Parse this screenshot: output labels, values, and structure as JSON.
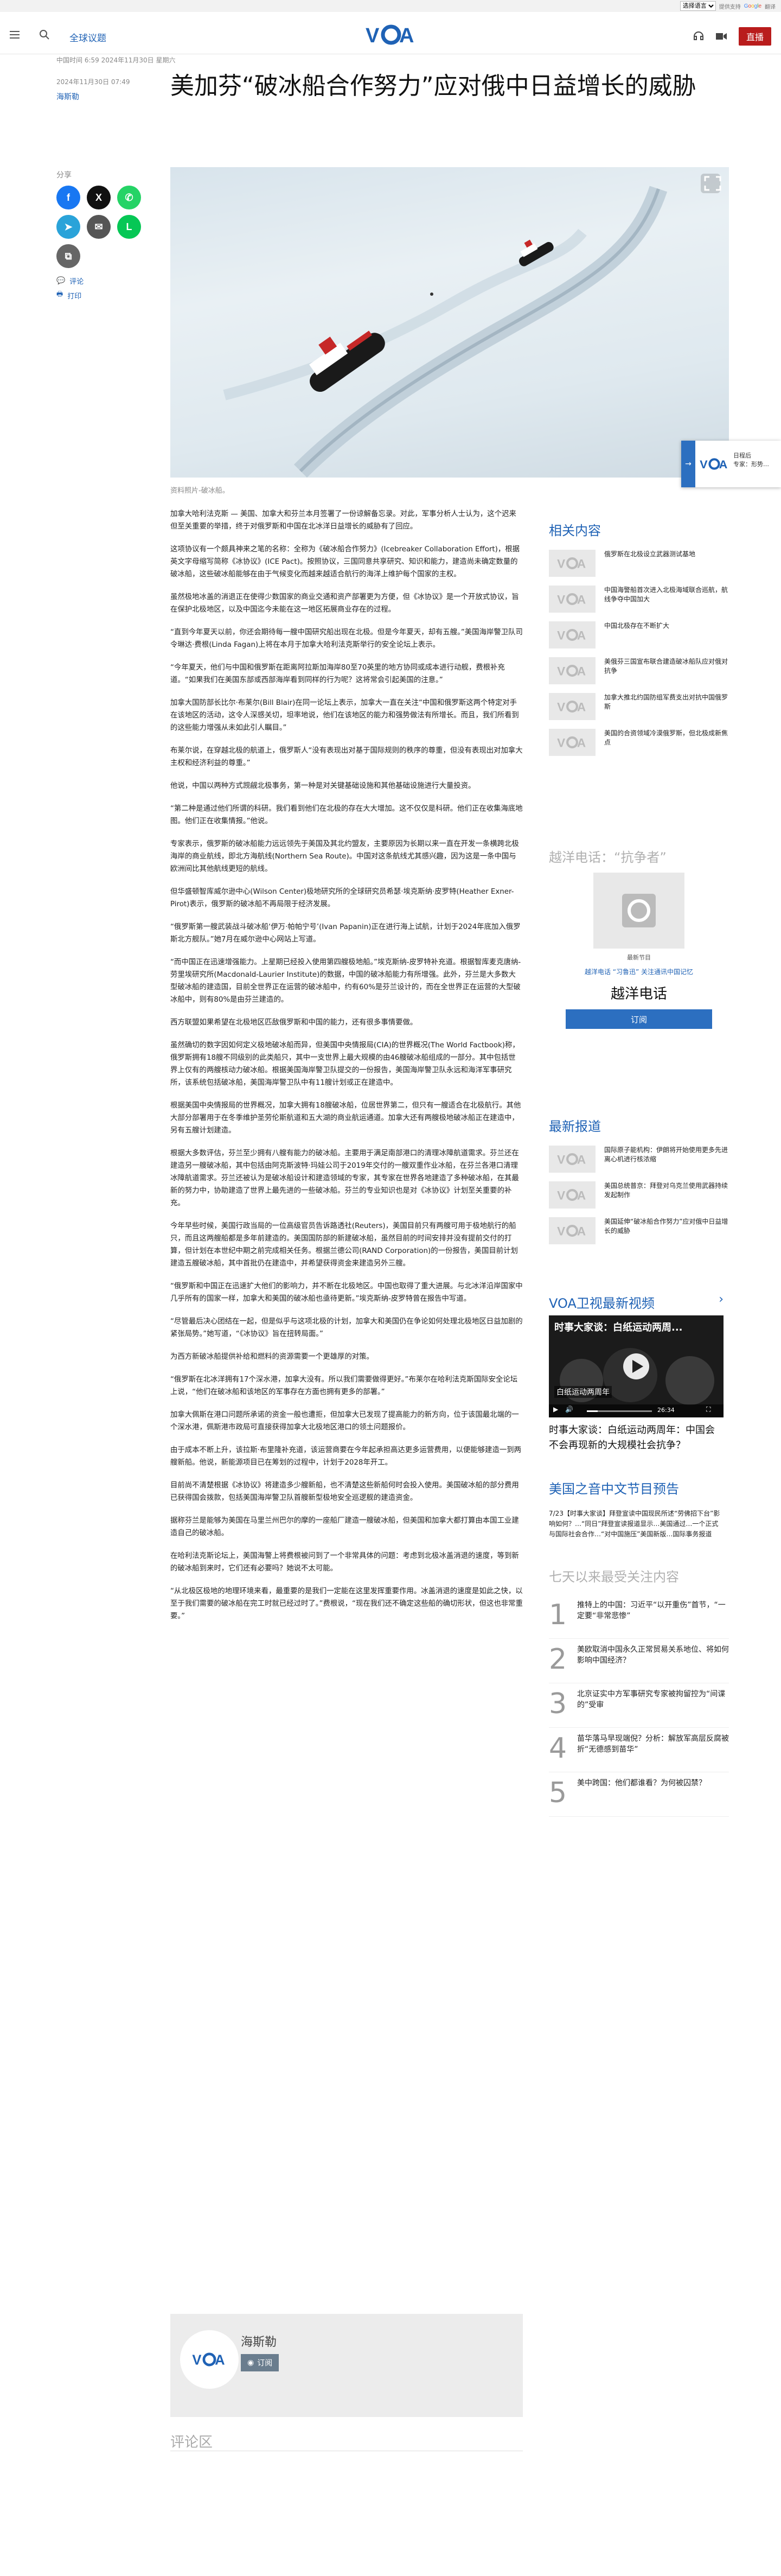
{
  "translate_bar": {
    "select_value": "选择语言",
    "powered_by": "提供支持",
    "google_text": "Google",
    "translate_word": "翻译"
  },
  "header": {
    "section": "全球议题",
    "logo_text": "VOA",
    "live_label": "直播"
  },
  "article": {
    "update_meta": "中国时间 6:59 2024年11月30日 星期六",
    "date": "2024年11月30日 07:49",
    "author": "海斯勒",
    "headline": "美加芬“破冰船合作努力”应对俄中日益增长的威胁",
    "caption": "资料照片-破冰船。",
    "paragraphs": [
      "加拿大哈利法克斯 — 美国、加拿大和芬兰本月签署了一份谅解备忘录。对此，军事分析人士认为，这个迟来但至关重要的举措，终于对俄罗斯和中国在北冰洋日益增长的威胁有了回应。",
      "这项协议有一个颇具神来之笔的名称：全称为《破冰船合作努力》(Icebreaker Collaboration Effort)，根据英文字母缩写简称《冰协议》(ICE Pact)。按照协议，三国同意共享研究、知识和能力，建造尚未确定数量的破冰船，这些破冰船能够在由于气候变化而越来越适合航行的海洋上维护每个国家的主权。",
      "虽然极地冰盖的消退正在使得少数国家的商业交通和资产部署更为方便，但《冰协议》是一个开放式协议，旨在保护北极地区，以及中国迄今未能在这一地区拓展商业存在的过程。",
      "“直到今年夏天以前，你还会期待每一艘中国研究船出现在北极。但是今年夏天，却有五艘。”美国海岸警卫队司令琳达·费根(Linda Fagan)上将在本月于加拿大哈利法克斯举行的安全论坛上表示。",
      "“今年夏天，他们与中国和俄罗斯在距离阿拉斯加海岸80至70英里的地方协同或成本进行动舰，费根补充道。“如果我们在美国东部或西部海岸看到同样的行为呢？这将常会引起美国的注意。”",
      "加拿大国防部长比尔·布莱尔(Bill Blair)在同一论坛上表示，加拿大一直在关注“中国和俄罗斯这两个特定对手在该地区的活动，这令人深感关切，坦率地说，他们在该地区的能力和强势做法有所增长。而且，我们所看到的这些能力增强从未如此引人瞩目。”",
      "布莱尔说，在穿越北极的航道上，俄罗斯人“没有表现出对基于国际规则的秩序的尊重，但没有表现出对加拿大主权和经济利益的尊重。”",
      "他说，中国以两种方式觊觎北极事务，第一种是对关键基础设施和其他基础设施进行大量投资。",
      "“第二种是通过他们所谓的科研。我们看到他们在北极的存在大大增加。这不仅仅是科研。他们正在收集海底地图。他们正在收集情报。”他说。",
      "专家表示，俄罗斯的破冰船能力远远领先于美国及其北约盟友，主要原因为长期以来一直在开发一条横跨北极海岸的商业航线，即北方海航线(Northern Sea Route)。中国对这条航线尤其感兴趣，因为这是一条中国与欧洲间比其他航线更短的航线。",
      "但华盛顿智库威尔逊中心(Wilson Center)极地研究所的全球研究员希瑟·埃克斯纳·皮罗特(Heather Exner-Pirot)表示，俄罗斯的破冰船不再局限于经济发展。",
      "“俄罗斯第一艘武装战斗破冰船‘伊万·帕帕宁号’(Ivan Papanin)正在进行海上试航，计划于2024年底加入俄罗斯北方舰队。”她7月在威尔逊中心网站上写道。",
      "“而中国正在迅速增强能力。上星期已经投入使用第四艘极地船。”埃克斯纳-皮罗特补充道。根据智库麦克唐纳-劳里埃研究所(Macdonald-Laurier Institute)的数据，中国的破冰船能力有所增强。此外，芬兰是大多数大型破冰船的建造国，目前全世界正在运营的破冰船中，约有60%是芬兰设计的，而在全世界正在运营的大型破冰船中，则有80%是由芬兰建造的。",
      "西方联盟如果希望在北极地区匹敌俄罗斯和中国的能力，还有很多事情要做。",
      "虽然确切的数字因如何定义极地破冰船而异，但美国中央情报局(CIA)的世界概况(The World Factbook)称，俄罗斯拥有18艘不同级别的此类船只，其中一支世界上最大规模的由46艘破冰船组成的一部分。其中包括世界上仅有的两艘核动力破冰船。根据美国海岸警卫队提交的一份报告，美国海岸警卫队永远和海洋军事研究所，该系统包括破冰船，美国海岸警卫队中有11艘计划或正在建造中。",
      "根据美国中央情报局的世界概况，加拿大拥有18艘破冰船，位居世界第二，但只有一艘适合在北极航行。其他大部分部署用于在冬季维护圣劳伦斯航道和五大湖的商业航运通道。加拿大还有两艘极地破冰船正在建造中，另有五艘计划建造。",
      "根据大多数评估，芬兰至少拥有八艘有能力的破冰船。主要用于满足南部港口的清理冰障航道需求。芬兰还在建造另一艘破冰船，其中包括由阿克斯波特·玛娃公司于2019年交付的一艘双重作业冰船，在芬兰各港口清理冰障航道需求。芬兰还被认为是破冰船设计和建造领域的专家，其专家在世界各地建造了多种破冰船，在其最新的努力中，协助建造了世界上最先进的一些破冰船。芬兰的专业知识也是对《冰协议》计划至关重要的补充。",
      "今年早些时候，美国行政当局的一位高级官员告诉路透社(Reuters)，美国目前只有两艘可用于极地航行的船只，而且这两艘船都是多年前建造的。美国国防部的新建破冰船，虽然目前的时间安排并没有提前交付的打算，但计划在本世纪中期之前完成相关任务。根据兰德公司(RAND Corporation)的一份报告，美国目前计划建造五艘破冰船，其中首批仍在建造中，并希望获得资金来建造另外三艘。",
      "“俄罗斯和中国正在迅速扩大他们的影响力，并不断在北极地区。中国也取得了重大进展。与北冰洋沿岸国家中几乎所有的国家一样，加拿大和美国的破冰船也亟待更新。”埃克斯纳-皮罗特曾在报告中写道。",
      "“尽管最后决心团结在一起，但是似乎与这项北极的计划，加拿大和美国仍在争论如何处理北极地区日益加剧的紧张局势。”她写道，“《冰协议》旨在扭转局面。”",
      "为西方新破冰船提供补给和燃料的资源需要一个更雄厚的对策。",
      "“俄罗斯在北冰洋拥有17个深水港，加拿大没有。所以我们需要做得更好。”布莱尔在哈利法克斯国际安全论坛上说，“他们在破冰船和该地区的军事存在方面也拥有更多的部署。”",
      "加拿大佩斯在港口问题所承诺的资金一般也遭拒，但加拿大已发现了提高能力的新方向，位于该国最北端的一个深水港，佩斯港市政局可直接获得加拿大北极地区港口的领土问题报价。",
      "由于成本不断上升，该拉斯·布里隆补充道，该运营商要在今年起承担高达更多运营费用，以便能够建造一到两艘新船。他说，新能源项目已在筹划的过程中，计划于2028年开工。",
      "目前尚不清楚根据《冰协议》将建造多少艘新船，也不清楚这些新船何时会投入使用。美国破冰船的部分费用已获得国会拨款，包括美国海岸警卫队首艘新型极地安全巡逻舰的建造资金。",
      "据称芬兰是能够为美国在马里兰州巴尔的摩的一座船厂建造一艘破冰船，但美国和加拿大都打算由本国工业建造自己的破冰船。",
      "在哈利法克斯论坛上，美国海警上将费根被问到了一个非常具体的问题：考虑到北极冰盖消退的速度，等到新的破冰船到来时，它们还有必要吗？她说不太可能。",
      "“从北极区极地的地理环境来看，最重要的是我们一定能在这里发挥重要作用。冰盖消退的速度是如此之快，以至于我们需要的破冰船在完工时就已经过时了。”费根说，“现在我们还不确定这些船的确切形状，但这也非常重要。”"
    ],
    "author_card_name": "海斯勒",
    "subscribe_label": "订阅",
    "comments_title": "评论区"
  },
  "share": {
    "label": "分享",
    "comment_link": "评论",
    "print_link": "打印"
  },
  "sidebar": {
    "related_title": "相关内容",
    "related": [
      "俄罗斯在北极设立武器测试基地",
      "中国海警船首次进入北极海域联合巡航，航线争夺中国加大",
      "中国北极存在不断扩大",
      "美俄芬三国宣布联合建造破冰船队应对俄对抗争",
      "加拿大推北约国防组军费支出对抗中国俄罗斯",
      "美国的合资领域冷漠俄罗斯，但北极成新焦点"
    ],
    "program_title": "越洋电话：“抗争者”",
    "program_caption": "最新节目",
    "program_links": "越洋电话 “习鲁迅” 关注通讯中国记忆",
    "program_name": "越洋电话",
    "program_subscribe": "订阅",
    "latest_title": "最新报道",
    "latest": [
      "国际原子能机构：伊朗将开始使用更多先进离心机进行核浓缩",
      "美国总统普京：拜登对乌克兰使用武器持续发起制作",
      "美国延伸“破冰船合作努力”应对俄中日益增长的威胁"
    ],
    "video_section_title": "VOA卫视最新视频",
    "video_overlay": "时事大家谈：白纸运动两周...",
    "video_subtitle": "白纸运动两周年",
    "video_time": "26:34",
    "video_title": "时事大家谈：白纸运动两周年：中国会不会再现新的大规模社会抗争？",
    "episode_title": "美国之音中文节目预告",
    "episode_text": "7/23【时事大家谈】拜登宣读中国现民所述“劳佛招下台”影响如何？…“同日”拜登宣读报道显示…美国通过…一个正式与国际社会合作…“对中国施压”美国新版…国际事务报道",
    "top_title": "七天以来最受关注内容",
    "top_items": [
      "推特上的中国：习近平“以开重伤”首节，“一定要“非常悲惨”",
      "美欧取消中国永久正常贸易关系地位、将如何影响中国经济？",
      "北京证实中方军事研究专家被拘留控为“间谍的”受审",
      "苗华落马早现端倪？分析：解放军高层反腐被折“无德感到苗华”",
      "美中跨国：他们都谁看？为何被囚禁？"
    ],
    "numbers": [
      "1",
      "2",
      "3",
      "4",
      "5"
    ]
  },
  "floating": {
    "text_line1": "日程后",
    "text_line2": "专家：形势…"
  },
  "colors": {
    "brand_blue": "#1f62b5",
    "live_red": "#b91c1c",
    "subscribe_blue": "#2c6fc0"
  }
}
